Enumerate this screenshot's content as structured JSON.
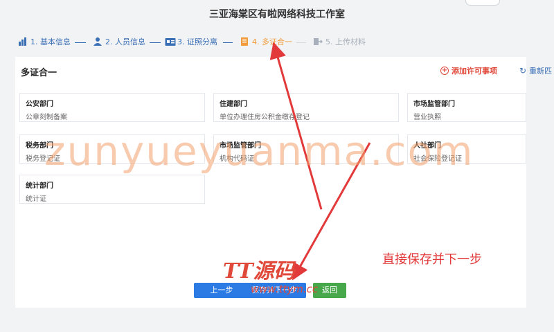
{
  "header": {
    "company_name": "三亚海棠区有啦网络科技工作室"
  },
  "steps": [
    {
      "label": "1. 基本信息",
      "state": "done",
      "icon": "bar-chart-icon"
    },
    {
      "label": "2. 人员信息",
      "state": "done",
      "icon": "person-icon"
    },
    {
      "label": "3. 证照分离",
      "state": "done",
      "icon": "id-card-icon"
    },
    {
      "label": "4. 多证合一",
      "state": "active",
      "icon": "certificate-icon"
    },
    {
      "label": "5. 上传材料",
      "state": "todo",
      "icon": "upload-icon"
    }
  ],
  "section": {
    "title": "多证合一",
    "add_permit_label": "添加许可事项",
    "reselect_label": "重新匹"
  },
  "departments": [
    {
      "name": "公安部门",
      "item": "公章刻制备案"
    },
    {
      "name": "住建部门",
      "item": "单位办理住房公积金缴存登记"
    },
    {
      "name": "市场监管部门",
      "item": "营业执照"
    },
    {
      "name": "税务部门",
      "item": "税务登记证"
    },
    {
      "name": "市场监管部门",
      "item": "机构代码证"
    },
    {
      "name": "人社部门",
      "item": "社会保险登记证"
    },
    {
      "name": "统计部门",
      "item": "统计证"
    }
  ],
  "buttons": {
    "prev": "上一步",
    "save": "保存并下一步",
    "back": "返回"
  },
  "annotation": {
    "text": "直接保存并下一步"
  },
  "watermarks": {
    "main": "zunyueyuanma.com",
    "logo": "TT源码",
    "url": "www.ttym.cc"
  },
  "colors": {
    "done": "#3a6fb6",
    "active": "#f29b38",
    "todo": "#a8b0bb",
    "primary": "#2c7be5",
    "success": "#46a84a",
    "danger": "#e0483a"
  }
}
